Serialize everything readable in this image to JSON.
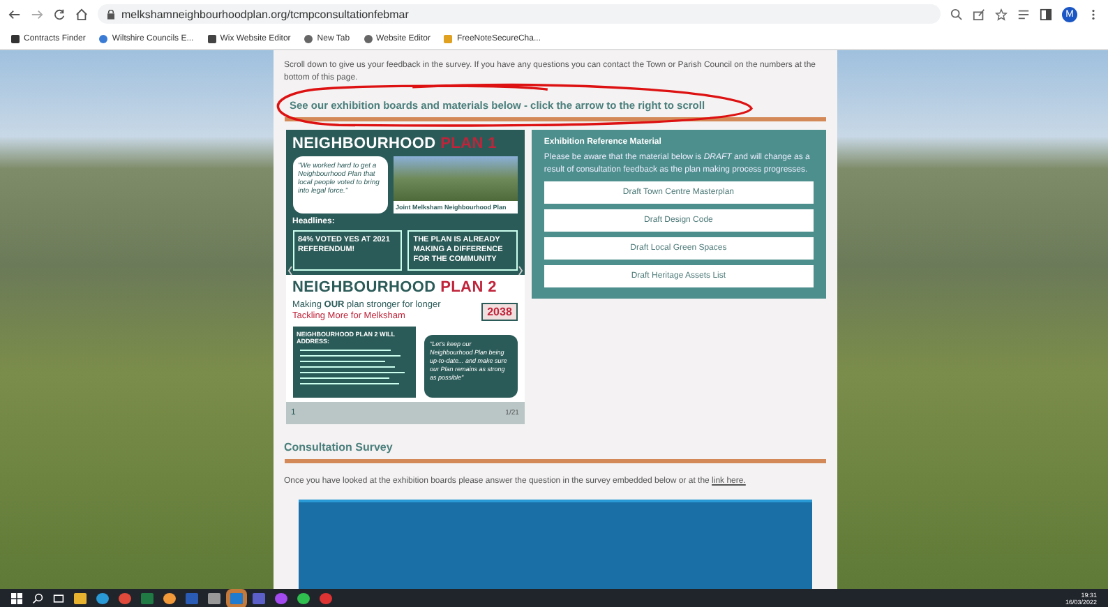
{
  "browser": {
    "url": "melkshamneighbourhoodplan.org/tcmpconsultationfebmar",
    "profile": "M",
    "bookmarks": [
      "Contracts Finder",
      "Wiltshire Councils E...",
      "Wix Website Editor",
      "New Tab",
      "Website Editor",
      "FreeNoteSecureCha..."
    ]
  },
  "page": {
    "intro": "Scroll down to give us your feedback in the survey.  If you have any questions you can contact the Town or Parish Council on the numbers at the bottom of this page.",
    "exhibition_heading": "See our exhibition boards and materials below - click the arrow to the right to scroll",
    "board": {
      "title": "NEIGHBOURHOOD",
      "title_accent": "PLAN 1",
      "quote": "\"We worked hard to get a Neighbourhood Plan that local people voted to bring into legal force.\"",
      "photo_caption": "Joint Melksham Neighbourhood Plan",
      "headlines": "Headlines:",
      "stat_1": "84% VOTED YES AT 2021 REFERENDUM!",
      "stat_2": "THE PLAN IS ALREADY MAKING A DIFFERENCE FOR THE COMMUNITY",
      "plan2_title": "NEIGHBOURHOOD",
      "plan2_accent": "PLAN 2",
      "tagline_1": "Making **OUR** plan stronger for longer",
      "tagline_2": "Tackling More for Melksham",
      "year": "2038",
      "address_title": "NEIGHBOURHOOD PLAN 2 WILL ADDRESS:",
      "quote_2": "\"Let's keep our Neighbourhood Plan being up-to-date... and make sure our Plan remains as strong as possible\"",
      "page_number": "1",
      "counter": "1/21"
    },
    "reference": {
      "title": "Exhibition Reference Material",
      "text": "Please be aware that the material below is *DRAFT* and will change as a result of consultation feedback as the plan making process progresses.",
      "buttons": [
        "Draft Town Centre Masterplan",
        "Draft Design Code",
        "Draft Local Green Spaces",
        "Draft Heritage Assets List"
      ]
    },
    "survey_heading": "Consultation Survey",
    "survey_text": "Once you have looked at the exhibition boards please answer the question in the survey embedded below or at the",
    "survey_link": "link here."
  },
  "taskbar": {
    "time": "19:31",
    "date": "16/03/2022"
  }
}
